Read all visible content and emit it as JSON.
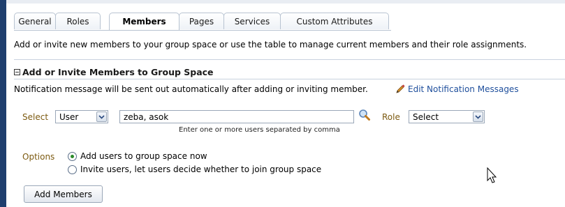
{
  "tabs": [
    {
      "label": "General",
      "active": false
    },
    {
      "label": "Roles",
      "active": false
    },
    {
      "label": "Members",
      "active": true
    },
    {
      "label": "Pages",
      "active": false
    },
    {
      "label": "Services",
      "active": false
    },
    {
      "label": "Custom Attributes",
      "active": false
    }
  ],
  "intro_text": "Add or invite new members to your group space or use the table to manage current members and their role assignments.",
  "section": {
    "title": "Add or Invite Members to Group Space",
    "notification_text": "Notification message will be sent out automatically after adding or inviting member.",
    "edit_link": "Edit Notification Messages"
  },
  "form": {
    "select_label": "Select",
    "select_value": "User",
    "users_value": "zeba, asok",
    "users_hint": "Enter one or more users separated by comma",
    "role_label": "Role",
    "role_value": "Select",
    "options_label": "Options",
    "options": [
      {
        "label": "Add users to group space now",
        "checked": true
      },
      {
        "label": "Invite users, let users decide whether to join group space",
        "checked": false
      }
    ],
    "add_button": "Add Members"
  },
  "colors": {
    "left_bar": "#1f3f6e",
    "link": "#1f4f9c",
    "field_label": "#7c5a10",
    "radio_selected": "#2a8a2a"
  },
  "icons": [
    "collapse-minus-icon",
    "pencil-icon",
    "search-icon",
    "chevron-down-icon",
    "mouse-pointer-icon"
  ]
}
